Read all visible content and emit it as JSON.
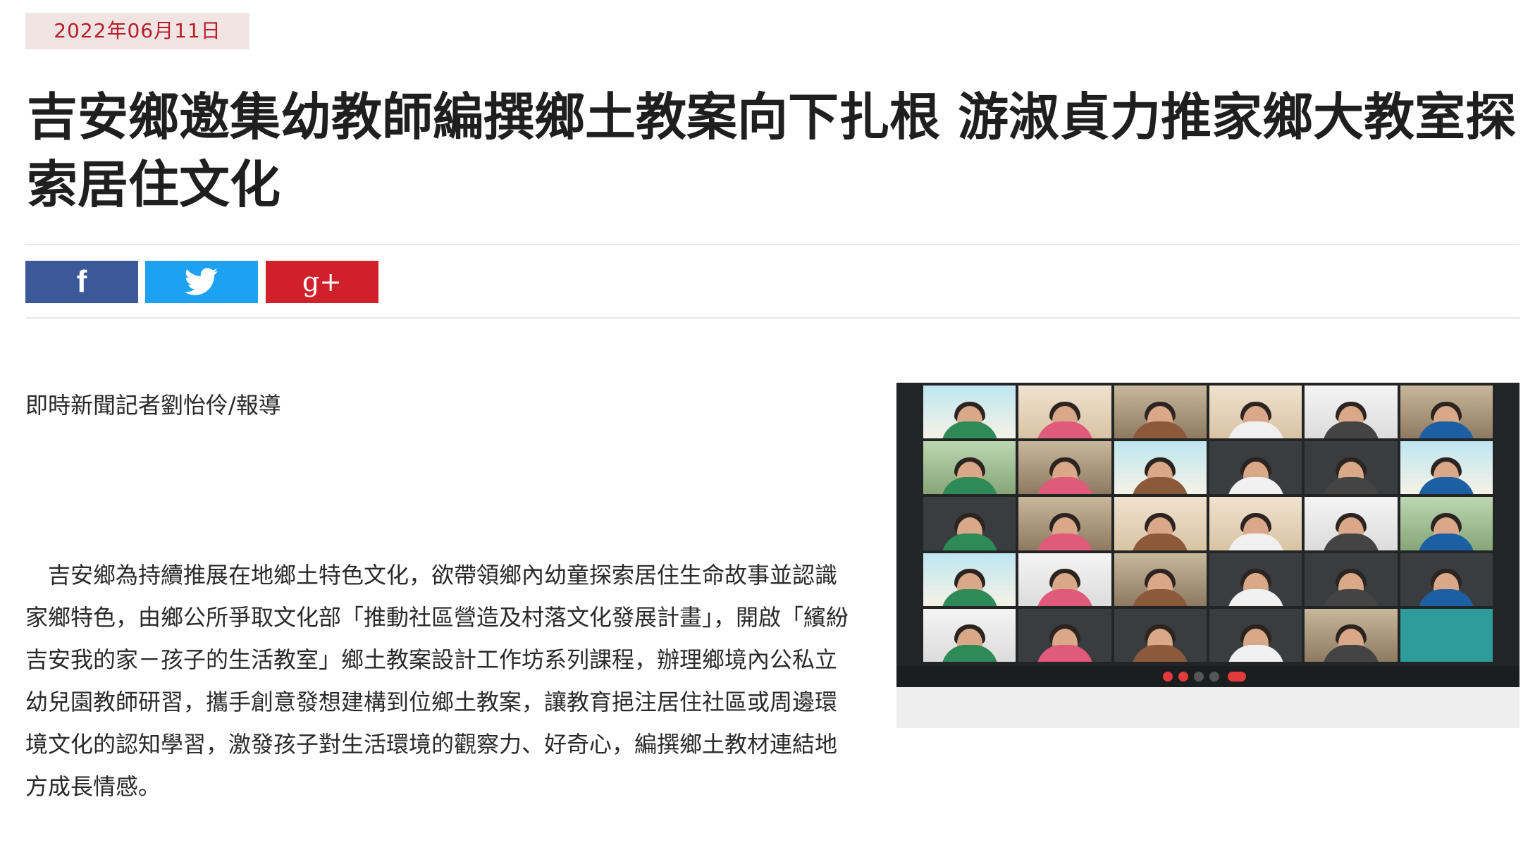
{
  "article": {
    "date": "2022年06月11日",
    "title": "吉安鄉邀集幼教師編撰鄉土教案向下扎根 游淑貞力推家鄉大教室探索居住文化",
    "byline": "即時新聞記者劉怡伶/報導",
    "body": "吉安鄉為持續推展在地鄉土特色文化，欲帶領鄉內幼童探索居住生命故事並認識家鄉特色，由鄉公所爭取文化部「推動社區營造及村落文化發展計畫」，開啟「繽紛吉安我的家－孩子的生活教室」鄉土教案設計工作坊系列課程，辦理鄉境內公私立幼兒園教師研習，攜手創意發想建構到位鄉土教案，讓教育挹注居住社區或周邊環境文化的認知學習，激發孩子對生活環境的觀察力、好奇心，編撰鄉土教材連結地方成長情感。"
  },
  "share": {
    "facebook": {
      "glyph": "f",
      "icon": "facebook-icon",
      "color": "#3b5998"
    },
    "twitter": {
      "icon": "twitter-bird-icon",
      "color": "#1da1f2"
    },
    "googleplus": {
      "glyph": "g+",
      "icon": "google-plus-icon",
      "color": "#d0212a"
    }
  },
  "photo": {
    "subject": "video-conference-grid",
    "tiles": 30
  }
}
